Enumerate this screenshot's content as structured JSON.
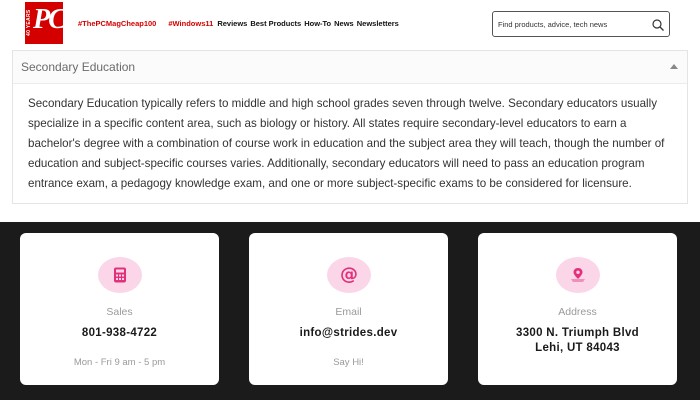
{
  "header": {
    "logo_text": "PC",
    "logo_years": "40 YEARS",
    "promos": [
      "#ThePCMagCheap100",
      "#Windows11"
    ],
    "nav_links": [
      "Reviews",
      "Best Products",
      "How-To",
      "News",
      "Newsletters"
    ],
    "search_placeholder": "Find products, advice, tech news",
    "brand_color": "#d40000"
  },
  "accordion": {
    "title": "Secondary Education",
    "expanded": true,
    "body": "Secondary Education typically refers to middle and high school grades seven through twelve. Secondary educators usually specialize in a specific content area, such as biology or history. All states require secondary-level educators to earn a bachelor's degree with a combination of course work in education and the subject area they will teach, though the number of education and subject-specific courses varies. Additionally, secondary educators will need to pass an education program entrance exam, a pedagogy knowledge exam, and one or more subject-specific exams to be considered for licensure."
  },
  "contact": {
    "accent_color": "#e3307a",
    "cards": [
      {
        "icon": "calculator-icon",
        "label": "Sales",
        "value": "801-938-4722",
        "sub": "Mon - Fri 9 am - 5 pm"
      },
      {
        "icon": "at-sign-icon",
        "label": "Email",
        "value": "info@strides.dev",
        "sub": "Say Hi!"
      },
      {
        "icon": "map-pin-icon",
        "label": "Address",
        "value_line1": "3300 N. Triumph Blvd",
        "value_line2": "Lehi, UT 84043"
      }
    ]
  }
}
